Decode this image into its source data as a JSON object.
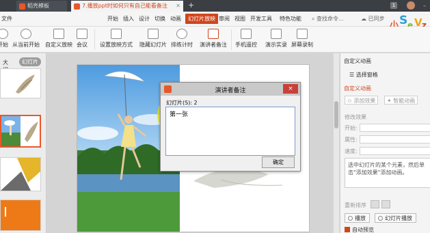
{
  "tabs": [
    {
      "label": "稻壳模板"
    },
    {
      "label": "7.播放ppt时如何只有自己能看备注"
    }
  ],
  "titlebar": {
    "badge": "1"
  },
  "menu": {
    "file": "文件",
    "items": [
      "开始",
      "插入",
      "设计",
      "切换",
      "动画",
      "幻灯片放映",
      "审阅",
      "视图",
      "开发工具",
      "特色功能"
    ],
    "search": "查找命令...",
    "sync": "已同步"
  },
  "toolbar": {
    "items": [
      {
        "label": "开始"
      },
      {
        "label": "从当前开始"
      },
      {
        "label": "自定义放映"
      },
      {
        "label": "会议"
      },
      {
        "label": "设置放映方式"
      },
      {
        "label": "隐藏幻灯片"
      },
      {
        "label": "排练计时"
      },
      {
        "label": "演讲者备注"
      },
      {
        "label": "手机遥控"
      },
      {
        "label": "演示实录"
      },
      {
        "label": "屏幕录制"
      }
    ]
  },
  "leftpanel": {
    "tab_outline": "大纲",
    "tab_slides": "幻灯片"
  },
  "dialog": {
    "title": "演讲者备注",
    "slide_label": "幻灯片(S): 2",
    "note_text": "第一张",
    "ok": "确定",
    "close": "×"
  },
  "rightpanel": {
    "title": "自定义动画",
    "pane": "选择窗格",
    "section": "自定义动画",
    "add_effect": "添加效果",
    "smart_anim": "智能动画",
    "modify": "修改效果",
    "start": "开始:",
    "property": "属性:",
    "speed": "速度:",
    "hint": "选中幻灯片的某个元素，然后单击\"添加效果\"添加动画。",
    "reorder": "重新排序",
    "play": "播放",
    "slideshow": "幻灯片播放",
    "autopreview": "自动预览"
  },
  "colors": {
    "accent": "#d0451b",
    "dialog_close": "#c7413a",
    "cursor_highlight": "#e8e800"
  }
}
